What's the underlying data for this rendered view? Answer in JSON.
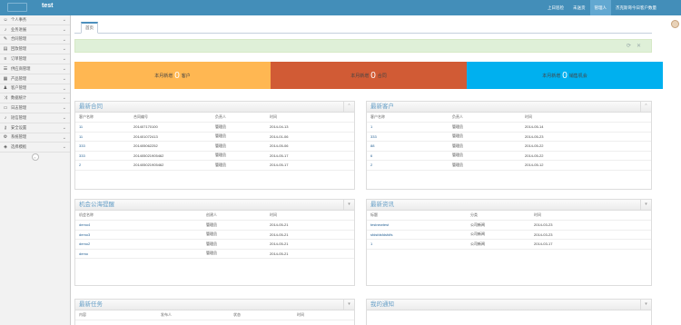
{
  "header": {
    "brand": "test",
    "nav": [
      "上日巡检",
      "未送货",
      "管理人",
      "杰克斯哥今日客户数量"
    ]
  },
  "sidebar": {
    "items": [
      {
        "label": "个人事务",
        "icon": "person-icon"
      },
      {
        "label": "业务进展",
        "icon": "bell-icon"
      },
      {
        "label": "合同管理",
        "icon": "edit-icon"
      },
      {
        "label": "回款管理",
        "icon": "book-icon"
      },
      {
        "label": "订单管理",
        "icon": "list-icon"
      },
      {
        "label": "供应商管理",
        "icon": "list-alt-icon"
      },
      {
        "label": "产品管理",
        "icon": "cart-icon"
      },
      {
        "label": "客户管理",
        "icon": "user-icon"
      },
      {
        "label": "数据统计",
        "icon": "shuffle-icon"
      },
      {
        "label": "日志管理",
        "icon": "file-icon"
      },
      {
        "label": "短信管理",
        "icon": "bell-icon"
      },
      {
        "label": "安全设置",
        "icon": "key-icon"
      },
      {
        "label": "系统管理",
        "icon": "gear-icon"
      },
      {
        "label": "选择模板",
        "icon": "cube-icon"
      }
    ]
  },
  "tabs": {
    "home": "首页"
  },
  "stats": [
    {
      "pre": "本月新增",
      "num": "0",
      "post": "客户",
      "color": "#ffb752"
    },
    {
      "pre": "本月新增",
      "num": "0",
      "post": "合同",
      "color": "#d15b35"
    },
    {
      "pre": "本月新增",
      "num": "0",
      "post": "销售机会",
      "color": "#00b0ef"
    }
  ],
  "contracts": {
    "title": "最新合同",
    "headers": [
      "客户名称",
      "合同编号",
      "负责人",
      "时间"
    ],
    "rows": [
      [
        "11",
        "201407170100",
        "管理员",
        "2014-04-13"
      ],
      [
        "11",
        "201401072413",
        "管理员",
        "2014-01-06"
      ],
      [
        "333",
        "201405062252",
        "管理员",
        "2014-05-06"
      ],
      [
        "333",
        "201405021905462",
        "管理员",
        "2014-05-17"
      ],
      [
        "2",
        "201405021905462",
        "管理员",
        "2014-05-17"
      ]
    ]
  },
  "customers": {
    "title": "最新客户",
    "headers": [
      "客户名称",
      "负责人",
      "时间"
    ],
    "rows": [
      [
        "1",
        "管理员",
        "2014-05-14"
      ],
      [
        "333",
        "管理员",
        "2014-05-23"
      ],
      [
        "88",
        "管理员",
        "2014-05-22"
      ],
      [
        "6",
        "管理员",
        "2014-05-22"
      ],
      [
        "2",
        "管理员",
        "2014-05-12"
      ]
    ]
  },
  "opportunities": {
    "title": "机会公海提醒",
    "headers": [
      "机会名称",
      "创建人",
      "时间"
    ],
    "rows": [
      [
        "demo4",
        "管理员",
        "2014-05-21"
      ],
      [
        "demo3",
        "管理员",
        "2014-05-21"
      ],
      [
        "demo2",
        "管理员",
        "2014-05-21"
      ],
      [
        "demo",
        "管理员",
        "2014-05-21"
      ]
    ]
  },
  "news": {
    "title": "最新资讯",
    "headers": [
      "标题",
      "分类",
      "时间"
    ],
    "rows": [
      [
        "testnewtest",
        "公司新闻",
        "2014-03-23"
      ],
      [
        "sfdsfdsfdsfdfs",
        "公司新闻",
        "2014-03-23"
      ],
      [
        "1",
        "公司新闻",
        "2014-03-17"
      ]
    ]
  },
  "tasks": {
    "title": "最新任务",
    "headers": [
      "内容",
      "发布人",
      "状态",
      "时间"
    ]
  },
  "notices": {
    "title": "我的通知"
  }
}
